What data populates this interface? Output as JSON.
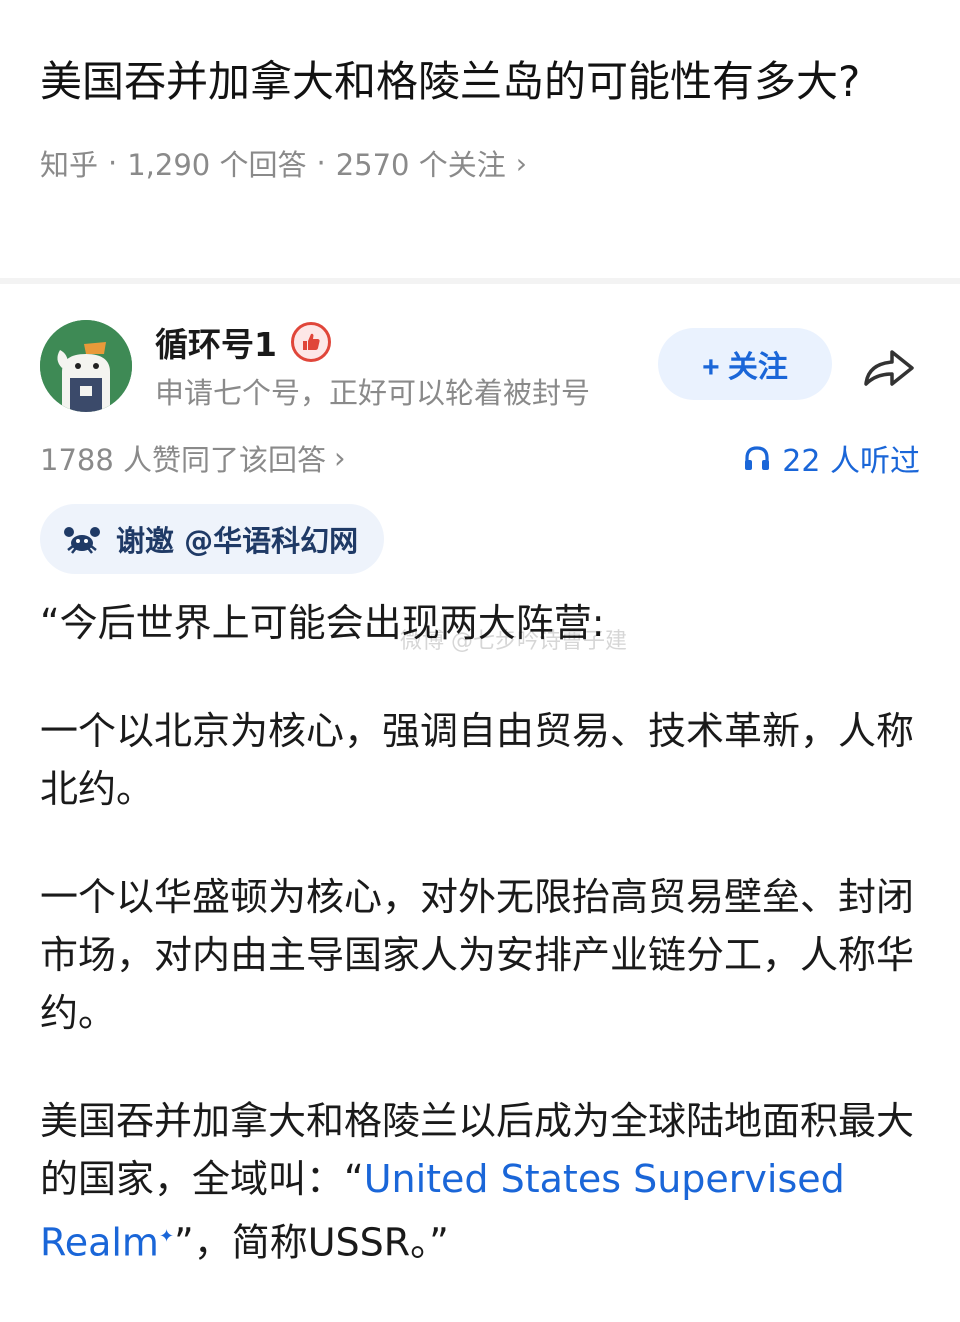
{
  "question": {
    "title": "美国吞并加拿大和格陵兰岛的可能性有多大?",
    "source": "知乎",
    "answers_count": "1,290 个回答",
    "followers_count": "2570 个关注",
    "chevron": "›"
  },
  "author": {
    "name": "循环号1",
    "bio": "申请七个号，正好可以轮着被封号",
    "badge_icon": "thumbs-up-badge-icon",
    "follow_label": "+ 关注",
    "share_icon": "share-arrow-icon"
  },
  "stats": {
    "likes": "1788 人赞同了该回答",
    "likes_chevron": "›",
    "listened": "22 人听过",
    "listen_icon": "headphones-icon"
  },
  "invite": {
    "icon": "crab-icon",
    "label": "谢邀 @华语科幻网"
  },
  "answer": {
    "p1": "“今后世界上可能会出现两大阵营:",
    "p2": "一个以北京为核心，强调自由贸易、技术革新，人称北约。",
    "p3": "一个以华盛顿为核心，对外无限抬高贸易壁垒、封闭市场，对内由主导国家人为安排产业链分工，人称华约。",
    "p4_prefix": "美国吞并加拿大和格陵兰以后成为全球陆地面积最大的国家，全域叫：“",
    "p4_link": "United States Supervised Realm",
    "p4_sup": "✦",
    "p4_suffix": "”，简称USSR。”"
  },
  "watermark": "微博 @七步吟诗曹子建",
  "colors": {
    "accent_blue": "#1a66d8",
    "meta_gray": "#8a8a8a",
    "avatar_green": "#3e8a55",
    "follow_bg": "#eaf2fe",
    "invite_bg": "#eef3fb"
  }
}
